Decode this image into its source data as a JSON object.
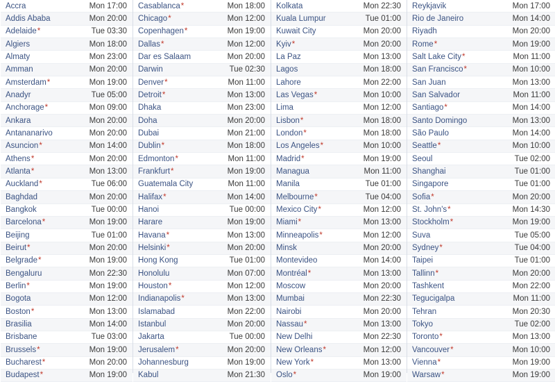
{
  "table": {
    "dst_marker": "*",
    "columns": [
      {
        "column_name": "cities-column-1",
        "rows": [
          {
            "city": "Accra",
            "dst": false,
            "time": "Mon 17:00"
          },
          {
            "city": "Addis Ababa",
            "dst": false,
            "time": "Mon 20:00"
          },
          {
            "city": "Adelaide",
            "dst": true,
            "time": "Tue 03:30"
          },
          {
            "city": "Algiers",
            "dst": false,
            "time": "Mon 18:00"
          },
          {
            "city": "Almaty",
            "dst": false,
            "time": "Mon 23:00"
          },
          {
            "city": "Amman",
            "dst": false,
            "time": "Mon 20:00"
          },
          {
            "city": "Amsterdam",
            "dst": true,
            "time": "Mon 19:00"
          },
          {
            "city": "Anadyr",
            "dst": false,
            "time": "Tue 05:00"
          },
          {
            "city": "Anchorage",
            "dst": true,
            "time": "Mon 09:00"
          },
          {
            "city": "Ankara",
            "dst": false,
            "time": "Mon 20:00"
          },
          {
            "city": "Antananarivo",
            "dst": false,
            "time": "Mon 20:00"
          },
          {
            "city": "Asuncion",
            "dst": true,
            "time": "Mon 14:00"
          },
          {
            "city": "Athens",
            "dst": true,
            "time": "Mon 20:00"
          },
          {
            "city": "Atlanta",
            "dst": true,
            "time": "Mon 13:00"
          },
          {
            "city": "Auckland",
            "dst": true,
            "time": "Tue 06:00"
          },
          {
            "city": "Baghdad",
            "dst": false,
            "time": "Mon 20:00"
          },
          {
            "city": "Bangkok",
            "dst": false,
            "time": "Tue 00:00"
          },
          {
            "city": "Barcelona",
            "dst": true,
            "time": "Mon 19:00"
          },
          {
            "city": "Beijing",
            "dst": false,
            "time": "Tue 01:00"
          },
          {
            "city": "Beirut",
            "dst": true,
            "time": "Mon 20:00"
          },
          {
            "city": "Belgrade",
            "dst": true,
            "time": "Mon 19:00"
          },
          {
            "city": "Bengaluru",
            "dst": false,
            "time": "Mon 22:30"
          },
          {
            "city": "Berlin",
            "dst": true,
            "time": "Mon 19:00"
          },
          {
            "city": "Bogota",
            "dst": false,
            "time": "Mon 12:00"
          },
          {
            "city": "Boston",
            "dst": true,
            "time": "Mon 13:00"
          },
          {
            "city": "Brasilia",
            "dst": false,
            "time": "Mon 14:00"
          },
          {
            "city": "Brisbane",
            "dst": false,
            "time": "Tue 03:00"
          },
          {
            "city": "Brussels",
            "dst": true,
            "time": "Mon 19:00"
          },
          {
            "city": "Bucharest",
            "dst": true,
            "time": "Mon 20:00"
          },
          {
            "city": "Budapest",
            "dst": true,
            "time": "Mon 19:00"
          }
        ]
      },
      {
        "column_name": "cities-column-2",
        "rows": [
          {
            "city": "Casablanca",
            "dst": true,
            "time": "Mon 18:00"
          },
          {
            "city": "Chicago",
            "dst": true,
            "time": "Mon 12:00"
          },
          {
            "city": "Copenhagen",
            "dst": true,
            "time": "Mon 19:00"
          },
          {
            "city": "Dallas",
            "dst": true,
            "time": "Mon 12:00"
          },
          {
            "city": "Dar es Salaam",
            "dst": false,
            "time": "Mon 20:00"
          },
          {
            "city": "Darwin",
            "dst": false,
            "time": "Tue 02:30"
          },
          {
            "city": "Denver",
            "dst": true,
            "time": "Mon 11:00"
          },
          {
            "city": "Detroit",
            "dst": true,
            "time": "Mon 13:00"
          },
          {
            "city": "Dhaka",
            "dst": false,
            "time": "Mon 23:00"
          },
          {
            "city": "Doha",
            "dst": false,
            "time": "Mon 20:00"
          },
          {
            "city": "Dubai",
            "dst": false,
            "time": "Mon 21:00"
          },
          {
            "city": "Dublin",
            "dst": true,
            "time": "Mon 18:00"
          },
          {
            "city": "Edmonton",
            "dst": true,
            "time": "Mon 11:00"
          },
          {
            "city": "Frankfurt",
            "dst": true,
            "time": "Mon 19:00"
          },
          {
            "city": "Guatemala City",
            "dst": false,
            "time": "Mon 11:00"
          },
          {
            "city": "Halifax",
            "dst": true,
            "time": "Mon 14:00"
          },
          {
            "city": "Hanoi",
            "dst": false,
            "time": "Tue 00:00"
          },
          {
            "city": "Harare",
            "dst": false,
            "time": "Mon 19:00"
          },
          {
            "city": "Havana",
            "dst": true,
            "time": "Mon 13:00"
          },
          {
            "city": "Helsinki",
            "dst": true,
            "time": "Mon 20:00"
          },
          {
            "city": "Hong Kong",
            "dst": false,
            "time": "Tue 01:00"
          },
          {
            "city": "Honolulu",
            "dst": false,
            "time": "Mon 07:00"
          },
          {
            "city": "Houston",
            "dst": true,
            "time": "Mon 12:00"
          },
          {
            "city": "Indianapolis",
            "dst": true,
            "time": "Mon 13:00"
          },
          {
            "city": "Islamabad",
            "dst": false,
            "time": "Mon 22:00"
          },
          {
            "city": "Istanbul",
            "dst": false,
            "time": "Mon 20:00"
          },
          {
            "city": "Jakarta",
            "dst": false,
            "time": "Tue 00:00"
          },
          {
            "city": "Jerusalem",
            "dst": true,
            "time": "Mon 20:00"
          },
          {
            "city": "Johannesburg",
            "dst": false,
            "time": "Mon 19:00"
          },
          {
            "city": "Kabul",
            "dst": false,
            "time": "Mon 21:30"
          }
        ]
      },
      {
        "column_name": "cities-column-3",
        "rows": [
          {
            "city": "Kolkata",
            "dst": false,
            "time": "Mon 22:30"
          },
          {
            "city": "Kuala Lumpur",
            "dst": false,
            "time": "Tue 01:00"
          },
          {
            "city": "Kuwait City",
            "dst": false,
            "time": "Mon 20:00"
          },
          {
            "city": "Kyiv",
            "dst": true,
            "time": "Mon 20:00"
          },
          {
            "city": "La Paz",
            "dst": false,
            "time": "Mon 13:00"
          },
          {
            "city": "Lagos",
            "dst": false,
            "time": "Mon 18:00"
          },
          {
            "city": "Lahore",
            "dst": false,
            "time": "Mon 22:00"
          },
          {
            "city": "Las Vegas",
            "dst": true,
            "time": "Mon 10:00"
          },
          {
            "city": "Lima",
            "dst": false,
            "time": "Mon 12:00"
          },
          {
            "city": "Lisbon",
            "dst": true,
            "time": "Mon 18:00"
          },
          {
            "city": "London",
            "dst": true,
            "time": "Mon 18:00"
          },
          {
            "city": "Los Angeles",
            "dst": true,
            "time": "Mon 10:00"
          },
          {
            "city": "Madrid",
            "dst": true,
            "time": "Mon 19:00"
          },
          {
            "city": "Managua",
            "dst": false,
            "time": "Mon 11:00"
          },
          {
            "city": "Manila",
            "dst": false,
            "time": "Tue 01:00"
          },
          {
            "city": "Melbourne",
            "dst": true,
            "time": "Tue 04:00"
          },
          {
            "city": "Mexico City",
            "dst": true,
            "time": "Mon 12:00"
          },
          {
            "city": "Miami",
            "dst": true,
            "time": "Mon 13:00"
          },
          {
            "city": "Minneapolis",
            "dst": true,
            "time": "Mon 12:00"
          },
          {
            "city": "Minsk",
            "dst": false,
            "time": "Mon 20:00"
          },
          {
            "city": "Montevideo",
            "dst": false,
            "time": "Mon 14:00"
          },
          {
            "city": "Montréal",
            "dst": true,
            "time": "Mon 13:00"
          },
          {
            "city": "Moscow",
            "dst": false,
            "time": "Mon 20:00"
          },
          {
            "city": "Mumbai",
            "dst": false,
            "time": "Mon 22:30"
          },
          {
            "city": "Nairobi",
            "dst": false,
            "time": "Mon 20:00"
          },
          {
            "city": "Nassau",
            "dst": true,
            "time": "Mon 13:00"
          },
          {
            "city": "New Delhi",
            "dst": false,
            "time": "Mon 22:30"
          },
          {
            "city": "New Orleans",
            "dst": true,
            "time": "Mon 12:00"
          },
          {
            "city": "New York",
            "dst": true,
            "time": "Mon 13:00"
          },
          {
            "city": "Oslo",
            "dst": true,
            "time": "Mon 19:00"
          }
        ]
      },
      {
        "column_name": "cities-column-4",
        "rows": [
          {
            "city": "Reykjavik",
            "dst": false,
            "time": "Mon 17:00"
          },
          {
            "city": "Rio de Janeiro",
            "dst": false,
            "time": "Mon 14:00"
          },
          {
            "city": "Riyadh",
            "dst": false,
            "time": "Mon 20:00"
          },
          {
            "city": "Rome",
            "dst": true,
            "time": "Mon 19:00"
          },
          {
            "city": "Salt Lake City",
            "dst": true,
            "time": "Mon 11:00"
          },
          {
            "city": "San Francisco",
            "dst": true,
            "time": "Mon 10:00"
          },
          {
            "city": "San Juan",
            "dst": false,
            "time": "Mon 13:00"
          },
          {
            "city": "San Salvador",
            "dst": false,
            "time": "Mon 11:00"
          },
          {
            "city": "Santiago",
            "dst": true,
            "time": "Mon 14:00"
          },
          {
            "city": "Santo Domingo",
            "dst": false,
            "time": "Mon 13:00"
          },
          {
            "city": "São Paulo",
            "dst": false,
            "time": "Mon 14:00"
          },
          {
            "city": "Seattle",
            "dst": true,
            "time": "Mon 10:00"
          },
          {
            "city": "Seoul",
            "dst": false,
            "time": "Tue 02:00"
          },
          {
            "city": "Shanghai",
            "dst": false,
            "time": "Tue 01:00"
          },
          {
            "city": "Singapore",
            "dst": false,
            "time": "Tue 01:00"
          },
          {
            "city": "Sofia",
            "dst": true,
            "time": "Mon 20:00"
          },
          {
            "city": "St. John's",
            "dst": true,
            "time": "Mon 14:30"
          },
          {
            "city": "Stockholm",
            "dst": true,
            "time": "Mon 19:00"
          },
          {
            "city": "Suva",
            "dst": false,
            "time": "Tue 05:00"
          },
          {
            "city": "Sydney",
            "dst": true,
            "time": "Tue 04:00"
          },
          {
            "city": "Taipei",
            "dst": false,
            "time": "Tue 01:00"
          },
          {
            "city": "Tallinn",
            "dst": true,
            "time": "Mon 20:00"
          },
          {
            "city": "Tashkent",
            "dst": false,
            "time": "Mon 22:00"
          },
          {
            "city": "Tegucigalpa",
            "dst": false,
            "time": "Mon 11:00"
          },
          {
            "city": "Tehran",
            "dst": false,
            "time": "Mon 20:30"
          },
          {
            "city": "Tokyo",
            "dst": false,
            "time": "Tue 02:00"
          },
          {
            "city": "Toronto",
            "dst": true,
            "time": "Mon 13:00"
          },
          {
            "city": "Vancouver",
            "dst": true,
            "time": "Mon 10:00"
          },
          {
            "city": "Vienna",
            "dst": true,
            "time": "Mon 19:00"
          },
          {
            "city": "Warsaw",
            "dst": true,
            "time": "Mon 19:00"
          }
        ]
      }
    ]
  },
  "colors": {
    "city_link": "#3b5383",
    "time_text": "#3a3a3a",
    "dst_star": "#c0392b",
    "row_stripe": "#f5f6f8",
    "row_base": "#ffffff",
    "row_border": "#eceff3",
    "column_divider": "#d8dde6"
  }
}
